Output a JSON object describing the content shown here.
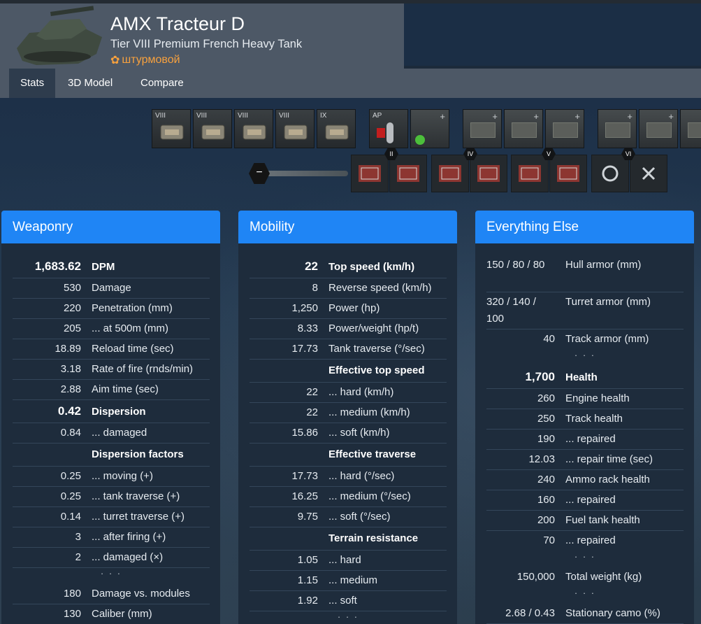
{
  "tank": {
    "name": "AMX Tracteur D",
    "subtitle": "Tier VIII Premium French Heavy Tank",
    "role": "штурмовой"
  },
  "tabs": [
    {
      "label": "Stats",
      "active": true
    },
    {
      "label": "3D Model",
      "active": false
    },
    {
      "label": "Compare",
      "active": false
    }
  ],
  "modules": {
    "tiers": [
      "VIII",
      "VIII",
      "VIII",
      "VIII",
      "IX"
    ],
    "names": [
      "gun-icon",
      "turret-icon",
      "engine-icon",
      "tracks-icon",
      "radio-icon"
    ],
    "ammo_label": "AP"
  },
  "field_mods": {
    "tiers": [
      "II",
      "IV",
      "V",
      "VI"
    ],
    "slider_minus": "−"
  },
  "panels": {
    "weaponry": {
      "title": "Weaponry",
      "rows": [
        {
          "v": "1,683.62",
          "l": "DPM",
          "kind": "big"
        },
        {
          "v": "530",
          "l": "Damage"
        },
        {
          "v": "220",
          "l": "Penetration (mm)"
        },
        {
          "v": "205",
          "l": "... at 500m (mm)"
        },
        {
          "v": "18.89",
          "l": "Reload time (sec)"
        },
        {
          "v": "3.18",
          "l": "Rate of fire (rnds/min)"
        },
        {
          "v": "2.88",
          "l": "Aim time (sec)"
        },
        {
          "v": "0.42",
          "l": "Dispersion",
          "kind": "big"
        },
        {
          "v": "0.84",
          "l": "... damaged"
        },
        {
          "v": "",
          "l": "Dispersion factors",
          "kind": "sub"
        },
        {
          "v": "0.25",
          "l": "... moving (+)"
        },
        {
          "v": "0.25",
          "l": "... tank traverse (+)"
        },
        {
          "v": "0.14",
          "l": "... turret traverse (+)"
        },
        {
          "v": "3",
          "l": "... after firing (+)"
        },
        {
          "v": "2",
          "l": "... damaged (×)"
        },
        {
          "v": "",
          "l": "· · ·",
          "kind": "dots"
        },
        {
          "v": "180",
          "l": "Damage vs. modules"
        },
        {
          "v": "130",
          "l": "Caliber (mm)"
        }
      ]
    },
    "mobility": {
      "title": "Mobility",
      "rows": [
        {
          "v": "22",
          "l": "Top speed (km/h)",
          "kind": "big"
        },
        {
          "v": "8",
          "l": "Reverse speed (km/h)"
        },
        {
          "v": "1,250",
          "l": "Power (hp)"
        },
        {
          "v": "8.33",
          "l": "Power/weight (hp/t)"
        },
        {
          "v": "17.73",
          "l": "Tank traverse (°/sec)"
        },
        {
          "v": "",
          "l": "Effective top speed",
          "kind": "sub"
        },
        {
          "v": "22",
          "l": "... hard (km/h)"
        },
        {
          "v": "22",
          "l": "... medium (km/h)"
        },
        {
          "v": "15.86",
          "l": "... soft (km/h)"
        },
        {
          "v": "",
          "l": "Effective traverse",
          "kind": "sub"
        },
        {
          "v": "17.73",
          "l": "... hard (°/sec)"
        },
        {
          "v": "16.25",
          "l": "... medium (°/sec)"
        },
        {
          "v": "9.75",
          "l": "... soft (°/sec)"
        },
        {
          "v": "",
          "l": "Terrain resistance",
          "kind": "sub"
        },
        {
          "v": "1.05",
          "l": "... hard"
        },
        {
          "v": "1.15",
          "l": "... medium"
        },
        {
          "v": "1.92",
          "l": "... soft"
        },
        {
          "v": "",
          "l": "· · ·",
          "kind": "dots"
        }
      ]
    },
    "else": {
      "title": "Everything Else",
      "rows": [
        {
          "v": "150 / 80 / 80",
          "l": "Hull armor (mm)",
          "kind": "tall"
        },
        {
          "v": "320 / 140 / 100",
          "l": "Turret armor (mm)",
          "kind": "tall"
        },
        {
          "v": "40",
          "l": "Track armor (mm)",
          "kind": "noline"
        },
        {
          "v": "",
          "l": "· · ·",
          "kind": "dots"
        },
        {
          "v": "1,700",
          "l": "Health",
          "kind": "big"
        },
        {
          "v": "260",
          "l": "Engine health"
        },
        {
          "v": "250",
          "l": "Track health"
        },
        {
          "v": "190",
          "l": "... repaired"
        },
        {
          "v": "12.03",
          "l": "... repair time (sec)"
        },
        {
          "v": "240",
          "l": "Ammo rack health"
        },
        {
          "v": "160",
          "l": "... repaired"
        },
        {
          "v": "200",
          "l": "Fuel tank health"
        },
        {
          "v": "70",
          "l": "... repaired",
          "kind": "noline"
        },
        {
          "v": "",
          "l": "· · ·",
          "kind": "dots"
        },
        {
          "v": "150,000",
          "l": "Total weight (kg)",
          "kind": "noline"
        },
        {
          "v": "",
          "l": "· · ·",
          "kind": "dots"
        },
        {
          "v": "2.68 / 0.43",
          "l": "Stationary camo (%)"
        }
      ]
    }
  }
}
